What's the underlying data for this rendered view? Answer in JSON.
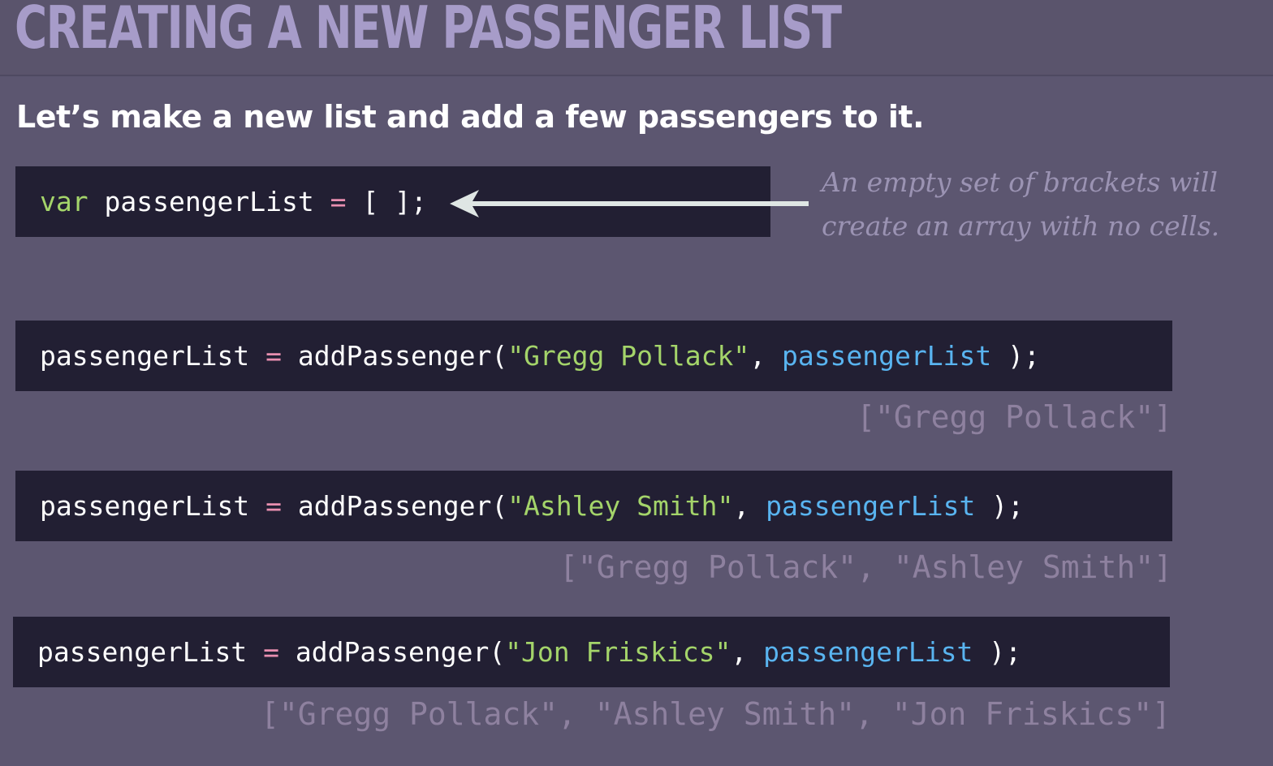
{
  "slide": {
    "title": "CREATING A NEW PASSENGER LIST",
    "subtitle": "Let’s make a new list and add a few passengers to it."
  },
  "code_lines": [
    {
      "keyword": "var",
      "target": "passengerList",
      "operator": "=",
      "expression": "[ ];"
    },
    {
      "target": "passengerList",
      "operator": "=",
      "function": "addPassenger(",
      "argument": "\"Gregg Pollack\"",
      "comma": ",",
      "param": "passengerList",
      "closing": " );"
    },
    {
      "target": "passengerList",
      "operator": "=",
      "function": "addPassenger(",
      "argument": "\"Ashley Smith\"",
      "comma": ",",
      "param": "passengerList",
      "closing": " );"
    },
    {
      "target": "passengerList",
      "operator": "=",
      "function": "addPassenger(",
      "argument": "\"Jon Friskics\"",
      "comma": ",",
      "param": "passengerList",
      "closing": " );"
    }
  ],
  "results": [
    "[\"Gregg Pollack\"]",
    "[\"Gregg Pollack\", \"Ashley Smith\"]",
    "[\"Gregg Pollack\", \"Ashley Smith\", \"Jon Friskics\"]"
  ],
  "annotation": {
    "line1": "An empty set of brackets will",
    "line2": "create an array with no cells."
  },
  "icons": {
    "arrow": "left-arrow-icon"
  },
  "colors": {
    "background": "#5c5670",
    "title": "#a79cc9",
    "code_background": "#221f33",
    "keyword": "#a4d46a",
    "string": "#a4d46a",
    "operator": "#e98fb0",
    "param": "#59b4f0",
    "result": "#8e819f"
  }
}
